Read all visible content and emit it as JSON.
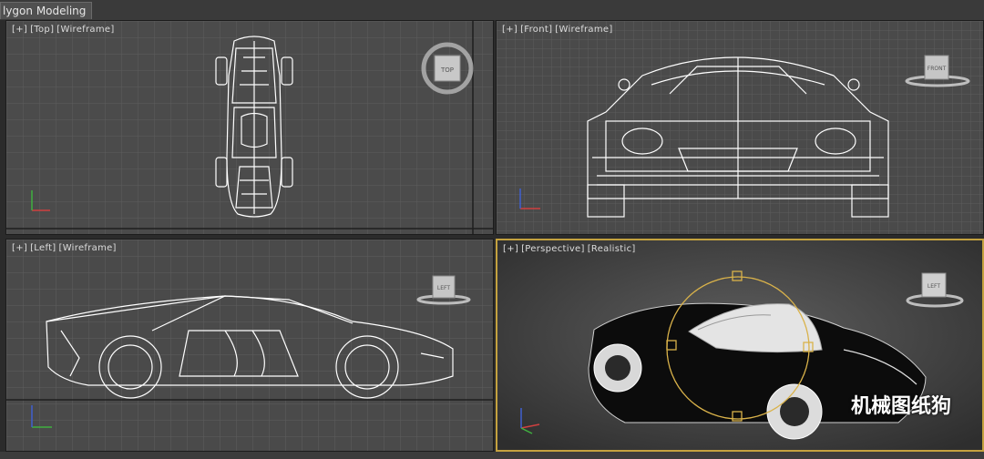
{
  "app": {
    "tab_label": "lygon Modeling"
  },
  "viewports": {
    "top": {
      "plus": "[+]",
      "view": "[Top]",
      "mode": "[Wireframe]",
      "cube_label": "TOP"
    },
    "front": {
      "plus": "[+]",
      "view": "[Front]",
      "mode": "[Wireframe]",
      "cube_label": "FRONT"
    },
    "left": {
      "plus": "[+]",
      "view": "[Left]",
      "mode": "[Wireframe]",
      "cube_label": "LEFT"
    },
    "perspective": {
      "plus": "[+]",
      "view": "[Perspective]",
      "mode": "[Realistic]",
      "cube_label": "LEFT"
    }
  },
  "watermark": "机械图纸狗",
  "colors": {
    "active_border": "#c4a23f",
    "viewport_bg": "#4b4b4b",
    "grid": "#5e5e5e",
    "wire": "#ffffff"
  },
  "icons": [
    "viewcube-icon",
    "axis-tripod-icon",
    "rotate-gizmo-icon"
  ]
}
